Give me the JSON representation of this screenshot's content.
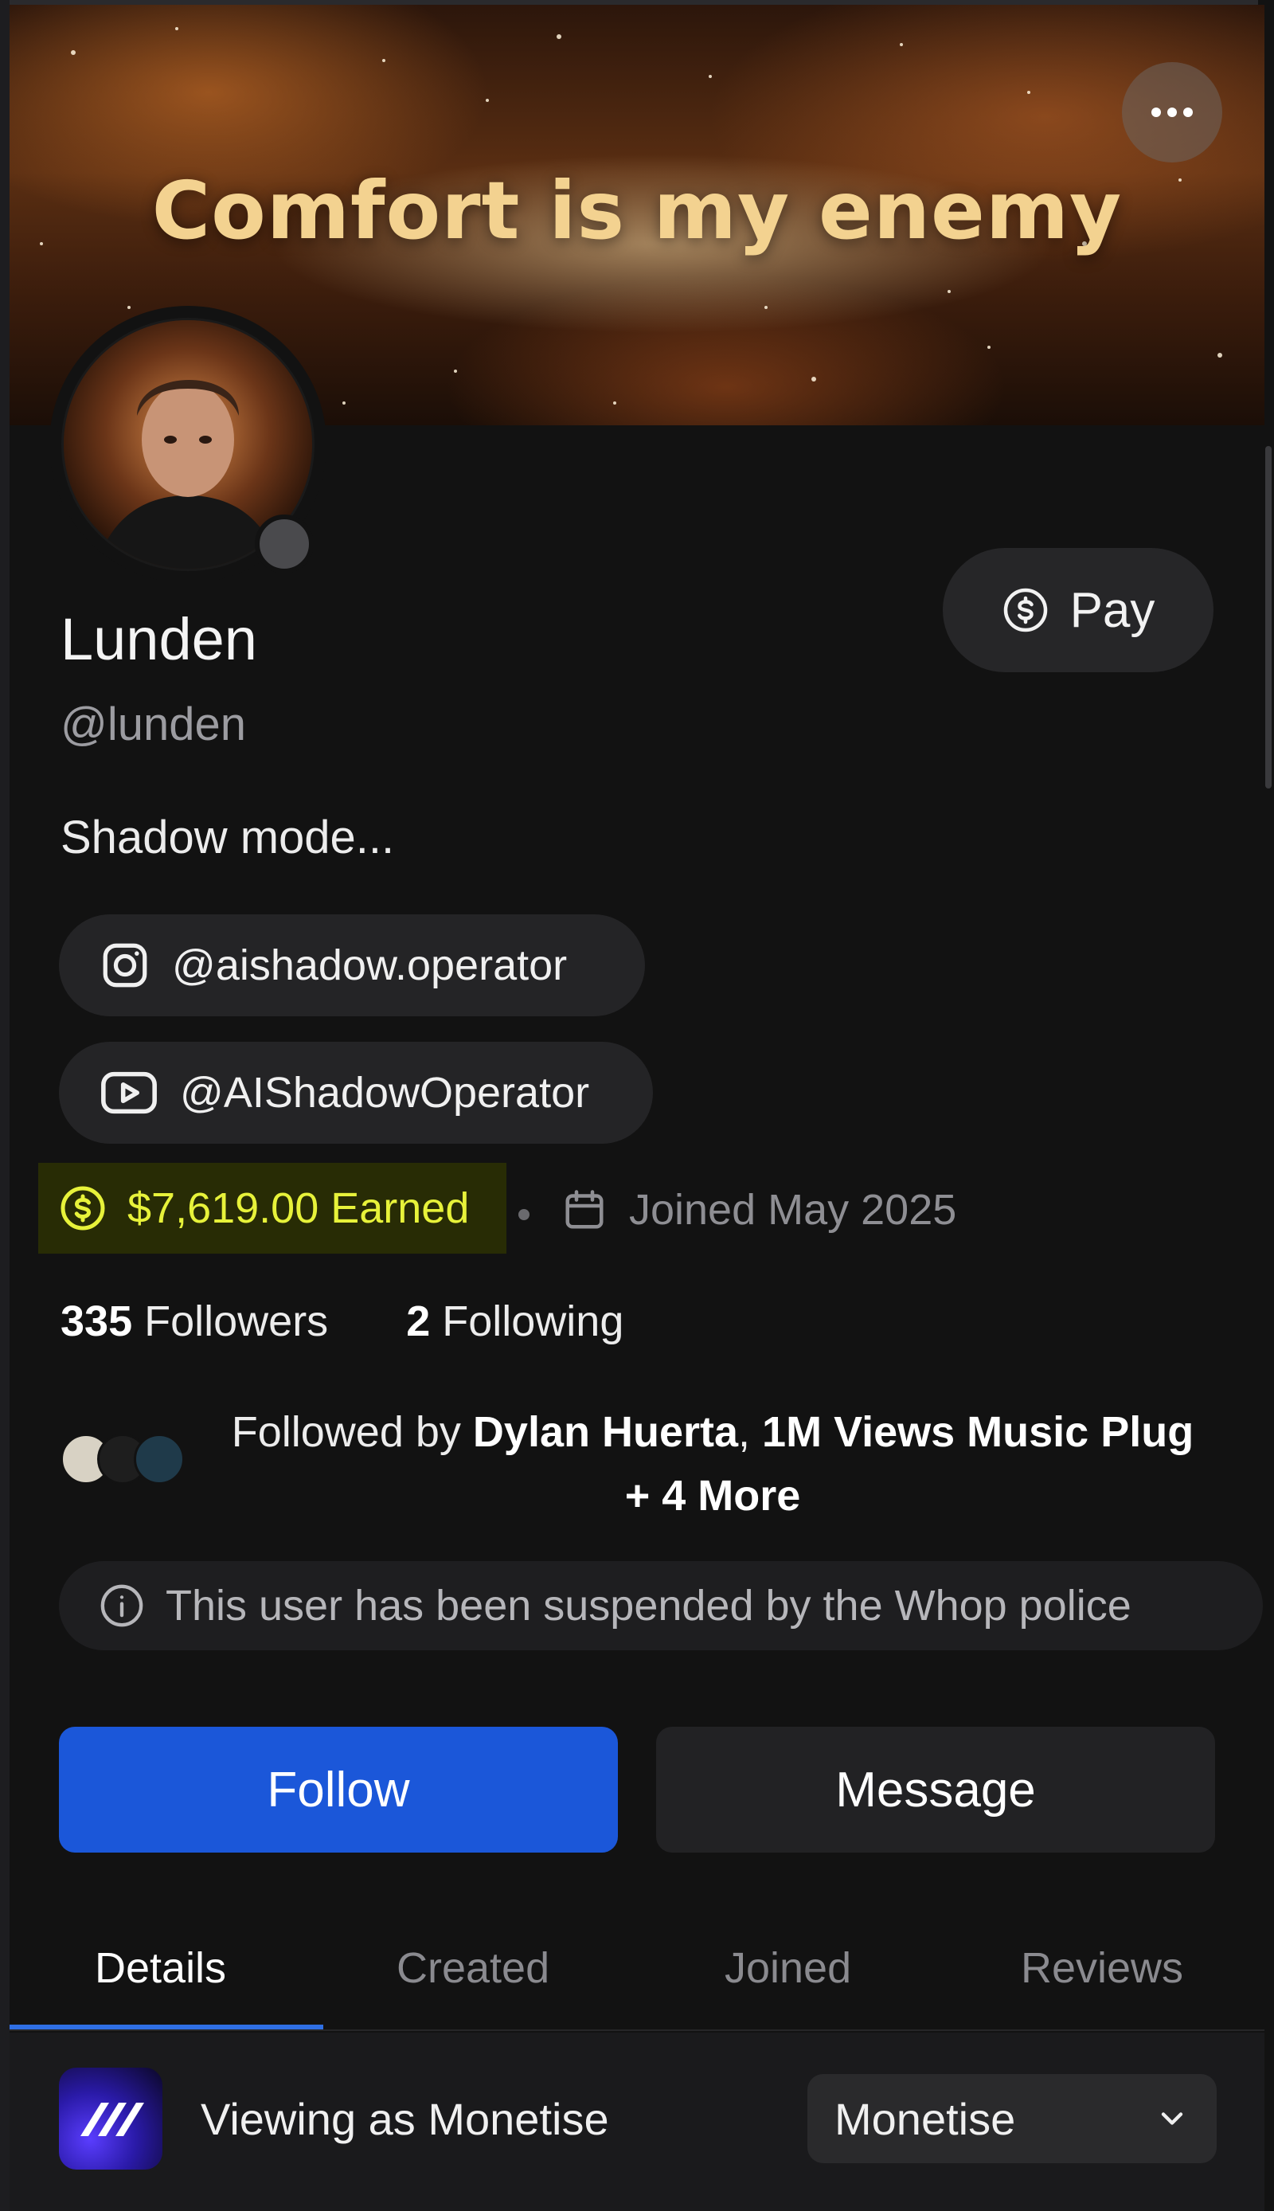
{
  "banner": {
    "headline": "Comfort is my enemy"
  },
  "profile": {
    "name": "Lunden",
    "handle": "@lunden",
    "bio": "Shadow mode..."
  },
  "pay_button": {
    "label": "Pay"
  },
  "socials": [
    {
      "platform": "instagram",
      "icon": "instagram-icon",
      "handle": "@aishadow.operator"
    },
    {
      "platform": "youtube",
      "icon": "youtube-icon",
      "handle": "@AIShadowOperator"
    }
  ],
  "earned": {
    "label": "$7,619.00 Earned",
    "accent": "#e7f23a"
  },
  "joined": {
    "label": "Joined May 2025"
  },
  "stats": {
    "followers_count": "335",
    "followers_label": "Followers",
    "following_count": "2",
    "following_label": "Following"
  },
  "followed_by": {
    "prefix": "Followed by ",
    "name1": "Dylan Huerta",
    "comma": ", ",
    "name2": "1M Views Music Plug + 4 More"
  },
  "notice": {
    "text": "This user has been suspended by the Whop police"
  },
  "actions": {
    "follow_label": "Follow",
    "message_label": "Message"
  },
  "tabs": [
    {
      "label": "Details",
      "active": true
    },
    {
      "label": "Created",
      "active": false
    },
    {
      "label": "Joined",
      "active": false
    },
    {
      "label": "Reviews",
      "active": false
    }
  ],
  "viewing": {
    "label": "Viewing as Monetise",
    "selected": "Monetise"
  },
  "colors": {
    "accent_blue": "#1b57d9",
    "background": "#121212",
    "earned_bg": "#282c05"
  }
}
